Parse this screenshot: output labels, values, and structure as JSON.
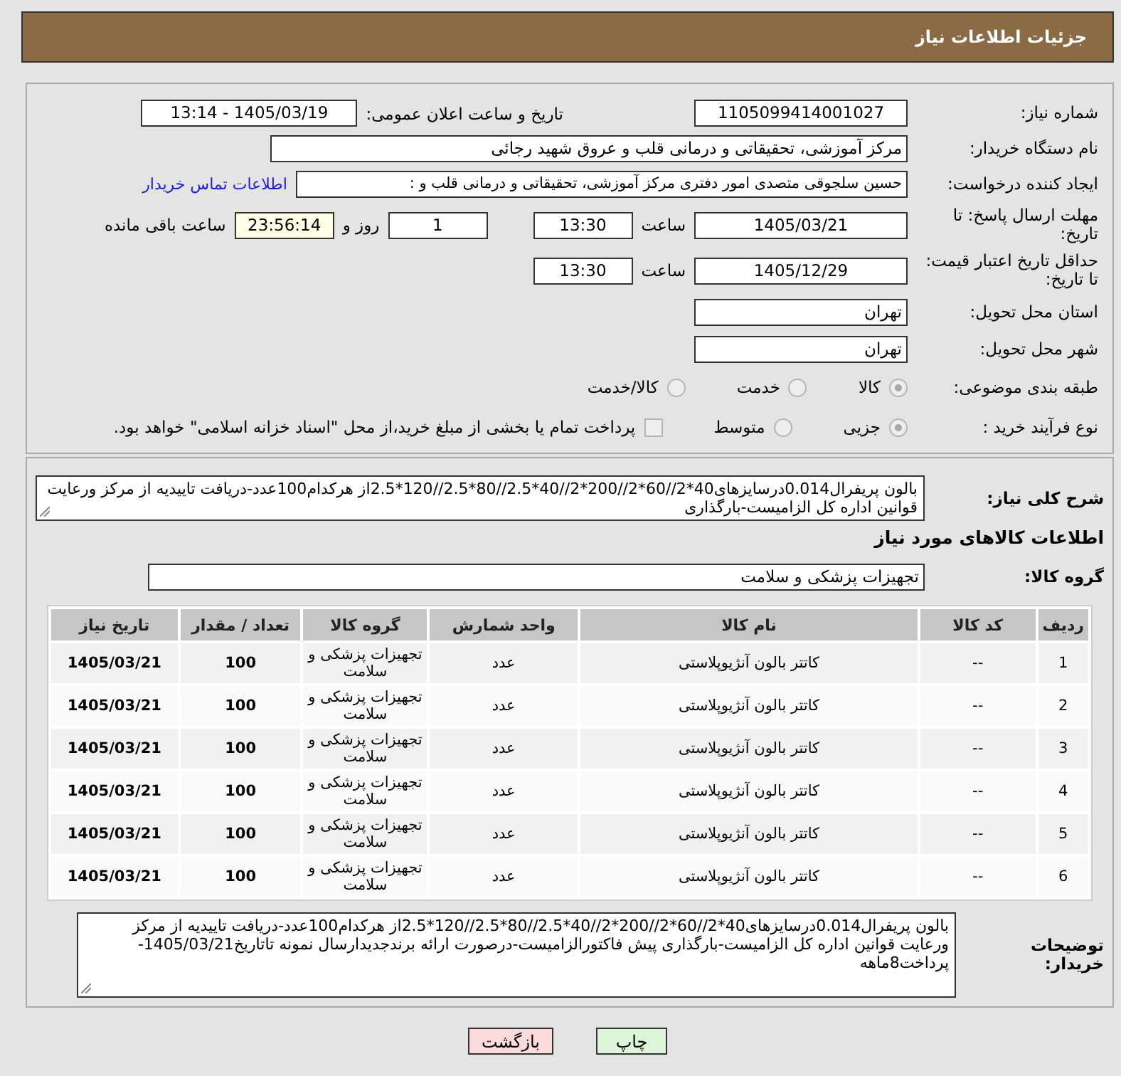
{
  "header": {
    "title": "جزئیات اطلاعات نیاز"
  },
  "need_number": {
    "label": "شماره نیاز:",
    "value": "1105099414001027"
  },
  "announce": {
    "label": "تاریخ و ساعت اعلان عمومی:",
    "value": "1405/03/19 - 13:14"
  },
  "buyer_org": {
    "label": "نام دستگاه خریدار:",
    "value": "مرکز آموزشی، تحقیقاتی و درمانی قلب و عروق شهید رجائی"
  },
  "requester": {
    "label": "ایجاد کننده درخواست:",
    "value": "حسین سلجوقی متصدی امور دفتری مرکز آموزشی، تحقیقاتی و درمانی قلب و :",
    "link": "اطلاعات تماس خریدار"
  },
  "reply_deadline": {
    "label": "مهلت ارسال پاسخ: تا تاریخ:",
    "date": "1405/03/21",
    "time_label": "ساعت",
    "time": "13:30",
    "days": "1",
    "days_label": "روز و",
    "remaining": "23:56:14",
    "remaining_label": "ساعت باقی مانده"
  },
  "price_validity": {
    "label": "حداقل تاریخ اعتبار قیمت: تا تاریخ:",
    "date": "1405/12/29",
    "time_label": "ساعت",
    "time": "13:30"
  },
  "province": {
    "label": "استان محل تحویل:",
    "value": "تهران"
  },
  "city": {
    "label": "شهر محل تحویل:",
    "value": "تهران"
  },
  "category": {
    "label": "طبقه بندی موضوعی:",
    "options": [
      {
        "label": "کالا",
        "selected": true
      },
      {
        "label": "خدمت",
        "selected": false
      },
      {
        "label": "کالا/خدمت",
        "selected": false
      }
    ]
  },
  "process": {
    "label": "نوع فرآیند خرید :",
    "options": [
      {
        "label": "جزیی",
        "selected": true
      },
      {
        "label": "متوسط",
        "selected": false
      }
    ],
    "payment": {
      "label": "پرداخت تمام یا بخشی از مبلغ خرید،از محل \"اسناد خزانه اسلامی\" خواهد بود.",
      "checked": false
    }
  },
  "description": {
    "label": "شرح کلی نیاز:",
    "value": "بالون پریفرال0.014درسایزهای40*2//60*2//200*2//40*2.5//80*2.5//120*2.5از هرکدام100عدد-دریافت تاییدیه از مرکز ورعایت قوانین اداره کل الزامیست-بارگذاری"
  },
  "goods_title": "اطلاعات کالاهای مورد نیاز",
  "goods_group": {
    "label": "گروه کالا:",
    "value": "تجهیزات پزشکی و سلامت"
  },
  "table": {
    "columns": [
      "ردیف",
      "کد کالا",
      "نام کالا",
      "واحد شمارش",
      "گروه کالا",
      "تعداد / مقدار",
      "تاریخ نیاز"
    ],
    "rows": [
      [
        "1",
        "--",
        "کاتتر بالون آنژیوپلاستی",
        "عدد",
        "تجهیزات پزشکی و سلامت",
        "100",
        "1405/03/21"
      ],
      [
        "2",
        "--",
        "کاتتر بالون آنژیوپلاستی",
        "عدد",
        "تجهیزات پزشکی و سلامت",
        "100",
        "1405/03/21"
      ],
      [
        "3",
        "--",
        "کاتتر بالون آنژیوپلاستی",
        "عدد",
        "تجهیزات پزشکی و سلامت",
        "100",
        "1405/03/21"
      ],
      [
        "4",
        "--",
        "کاتتر بالون آنژیوپلاستی",
        "عدد",
        "تجهیزات پزشکی و سلامت",
        "100",
        "1405/03/21"
      ],
      [
        "5",
        "--",
        "کاتتر بالون آنژیوپلاستی",
        "عدد",
        "تجهیزات پزشکی و سلامت",
        "100",
        "1405/03/21"
      ],
      [
        "6",
        "--",
        "کاتتر بالون آنژیوپلاستی",
        "عدد",
        "تجهیزات پزشکی و سلامت",
        "100",
        "1405/03/21"
      ]
    ]
  },
  "buyer_notes": {
    "label": "توضیحات خریدار:",
    "value": "بالون پریفرال0.014درسایزهای40*2//60*2//200*2//40*2.5//80*2.5//120*2.5از هرکدام100عدد-دریافت تاییدیه از مرکز ورعایت قوانین اداره کل الزامیست-بارگذاری پیش فاکتورالزامیست-درصورت ارائه برندجدیدارسال نمونه تاتاریخ1405/03/21-پرداخت8ماهه"
  },
  "buttons": [
    {
      "label": "چاپ",
      "kind": "print"
    },
    {
      "label": "بازگشت",
      "kind": "back"
    }
  ]
}
